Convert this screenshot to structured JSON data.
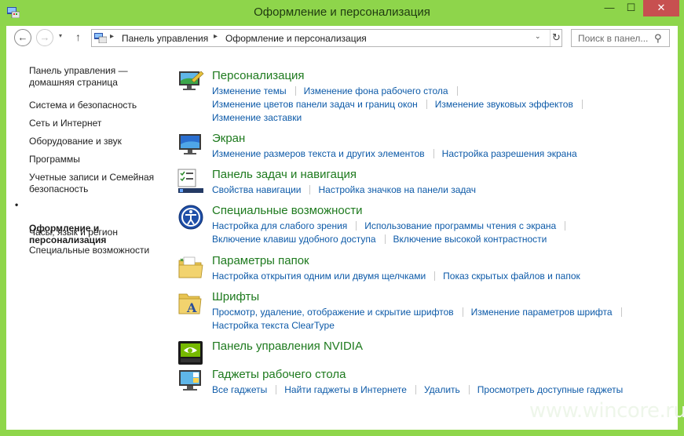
{
  "window": {
    "title": "Оформление и персонализация",
    "minimize": "—",
    "maximize": "☐",
    "close": "✕"
  },
  "navbar": {
    "back": "←",
    "forward": "→",
    "recent": "▾",
    "up": "↑",
    "breadcrumb": [
      "Панель управления",
      "Оформление и персонализация"
    ],
    "breadcrumb_separator": "▸",
    "dropdown": "⌄",
    "refresh": "↻",
    "search_placeholder": "Поиск в панел...",
    "search_icon": "⚲"
  },
  "sidebar": {
    "items": [
      {
        "label": "Панель управления —\nдомашняя страница",
        "active": false
      },
      {
        "label": "Система и безопасность",
        "active": false
      },
      {
        "label": "Сеть и Интернет",
        "active": false
      },
      {
        "label": "Оборудование и звук",
        "active": false
      },
      {
        "label": "Программы",
        "active": false
      },
      {
        "label": "Учетные записи и Семейная\nбезопасность",
        "active": false
      },
      {
        "label": "Оформление и\nперсонализация",
        "active": true
      },
      {
        "label": "Часы, язык и регион",
        "active": false
      },
      {
        "label": "Специальные возможности",
        "active": false
      }
    ],
    "bullet": "•"
  },
  "categories": [
    {
      "icon": "personalization-icon",
      "title": "Персонализация",
      "link_rows": [
        [
          "Изменение темы",
          "Изменение фона рабочего стола"
        ],
        [
          "Изменение цветов панели задач и границ окон",
          "Изменение звуковых эффектов"
        ],
        [
          "Изменение заставки"
        ]
      ]
    },
    {
      "icon": "display-icon",
      "title": "Экран",
      "link_rows": [
        [
          "Изменение размеров текста и других элементов",
          "Настройка разрешения экрана"
        ]
      ]
    },
    {
      "icon": "taskbar-icon",
      "title": "Панель задач и навигация",
      "link_rows": [
        [
          "Свойства навигации",
          "Настройка значков на панели задач"
        ]
      ]
    },
    {
      "icon": "ease-of-access-icon",
      "title": "Специальные возможности",
      "link_rows": [
        [
          "Настройка для слабого зрения",
          "Использование программы чтения с экрана"
        ],
        [
          "Включение клавиш удобного доступа",
          "Включение высокой контрастности"
        ]
      ]
    },
    {
      "icon": "folder-options-icon",
      "title": "Параметры папок",
      "link_rows": [
        [
          "Настройка открытия одним или двумя щелчками",
          "Показ скрытых файлов и папок"
        ]
      ]
    },
    {
      "icon": "fonts-icon",
      "title": "Шрифты",
      "link_rows": [
        [
          "Просмотр, удаление, отображение и скрытие шрифтов",
          "Изменение параметров шрифта"
        ],
        [
          "Настройка текста ClearType"
        ]
      ]
    },
    {
      "icon": "nvidia-icon",
      "title": "Панель управления NVIDIA",
      "link_rows": []
    },
    {
      "icon": "gadgets-icon",
      "title": "Гаджеты рабочего стола",
      "link_rows": [
        [
          "Все гаджеты",
          "Найти гаджеты в Интернете",
          "Удалить",
          "Просмотреть доступные гаджеты"
        ]
      ]
    }
  ],
  "watermark": "www.wincore.ru",
  "colors": {
    "frame": "#8fd64a",
    "category_title": "#1e7a1e",
    "link": "#0d5aa8",
    "close_button": "#c75050"
  }
}
